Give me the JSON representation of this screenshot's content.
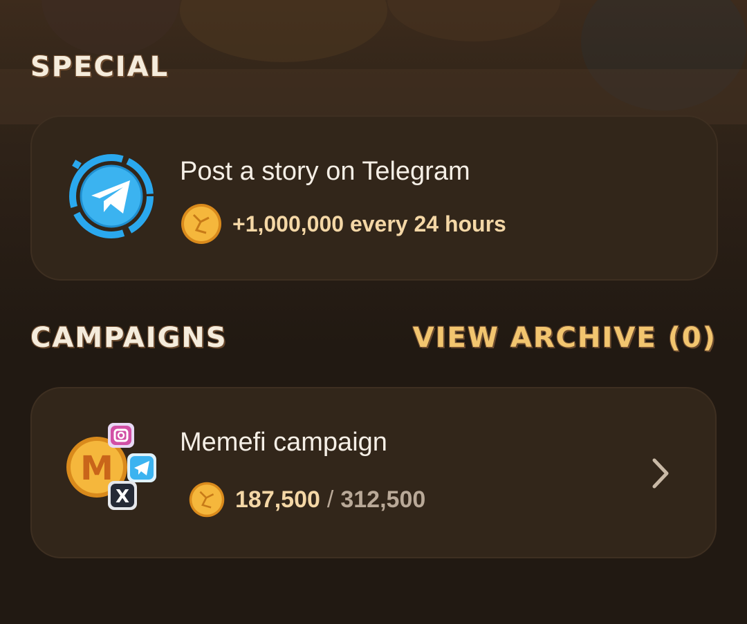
{
  "sections": {
    "special_title": "SPECIAL",
    "campaigns_title": "CAMPAIGNS",
    "archive_link": "VIEW ARCHIVE (0)"
  },
  "special_task": {
    "title": "Post a story on Telegram",
    "reward": "+1,000,000 every 24 hours",
    "icon": "telegram-icon"
  },
  "campaign": {
    "title": "Memefi campaign",
    "progress_current": "187,500",
    "progress_separator": "/",
    "progress_total": "312,500",
    "icon": "memefi-coin-icon"
  },
  "colors": {
    "background": "#211912",
    "card": "#32261a",
    "accent": "#f2c56f",
    "telegram_blue": "#2aa8ee",
    "coin": "#f0a830"
  }
}
